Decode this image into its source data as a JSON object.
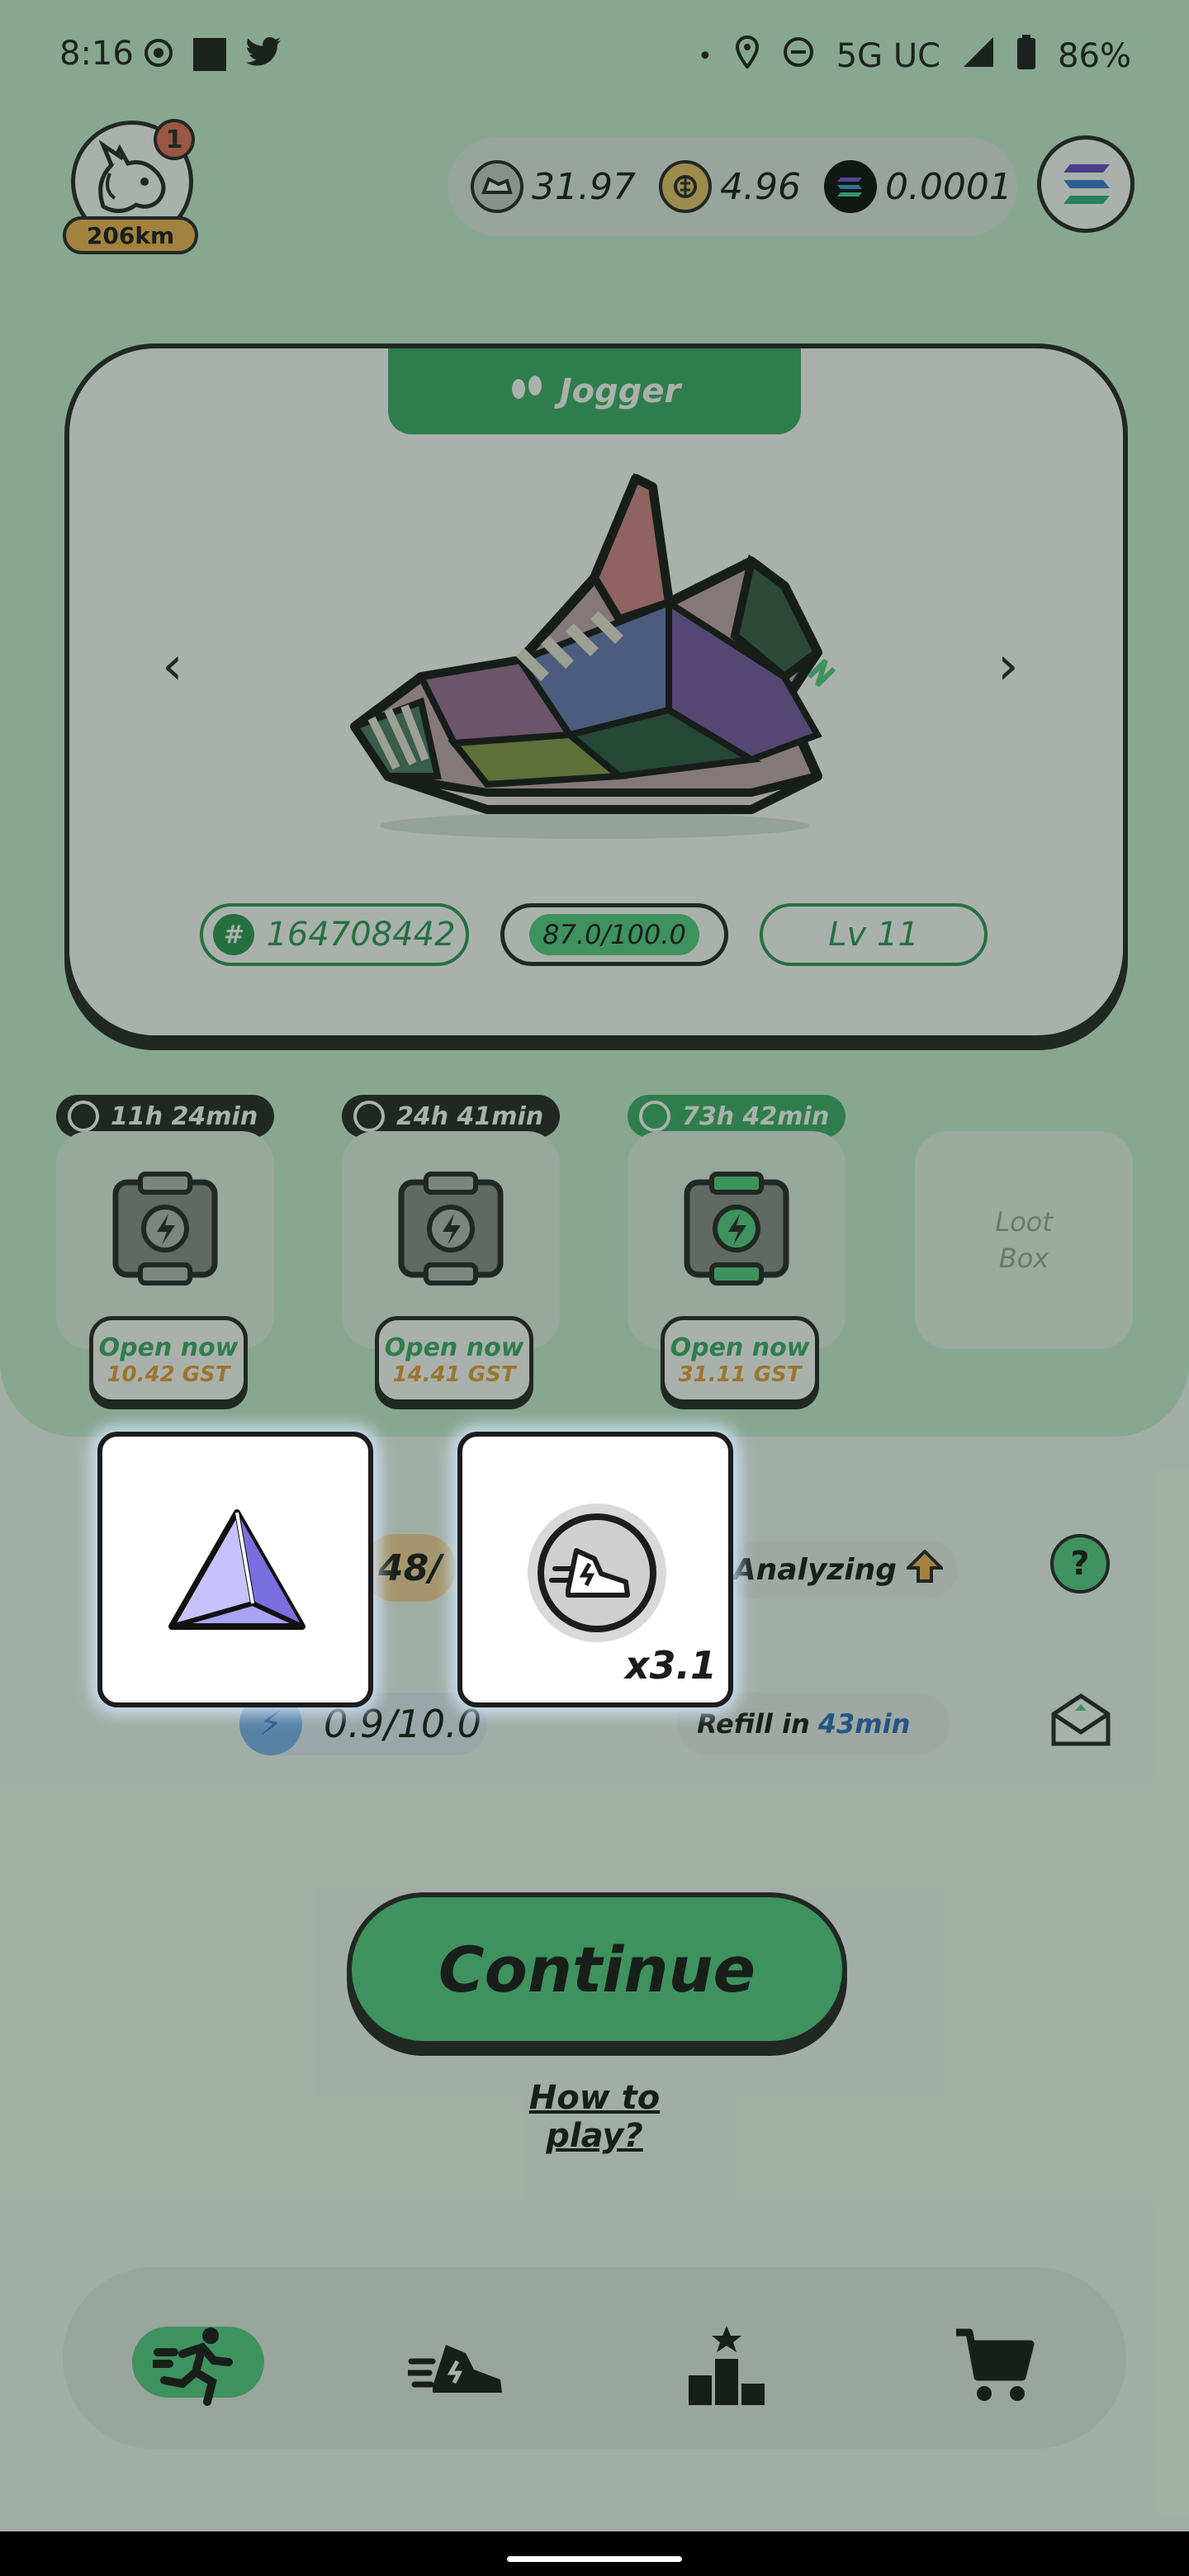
{
  "status_bar": {
    "time": "8:16",
    "network": "5G UC",
    "battery": "86%"
  },
  "profile": {
    "notification_count": "1",
    "distance": "206km"
  },
  "balances": [
    {
      "icon": "gst-shoe-coin-icon",
      "value": "31.97"
    },
    {
      "icon": "gmt-coin-icon",
      "value": "4.96"
    },
    {
      "icon": "solana-coin-icon",
      "value": "0.0001"
    }
  ],
  "sneaker_card": {
    "type": "Jogger",
    "id": "164708442",
    "durability": "87.0/100.0",
    "level": "Lv 11"
  },
  "mystery_boxes": [
    {
      "timer": "11h 24min",
      "open_label": "Open now",
      "cost": "10.42 GST",
      "active": false
    },
    {
      "timer": "24h 41min",
      "open_label": "Open now",
      "cost": "14.41 GST",
      "active": false
    },
    {
      "timer": "73h 42min",
      "open_label": "Open now",
      "cost": "31.11 GST",
      "active": true
    }
  ],
  "loot_box_placeholder": {
    "line1": "Loot",
    "line2": "Box"
  },
  "mint_progress_partial": "48/",
  "analyzing_label": "Analyzing",
  "energy": {
    "value": "0.9/10.0"
  },
  "refill": {
    "label": "Refill in",
    "minutes": "43min"
  },
  "rewards_overlay": {
    "items": [
      {
        "icon": "gem-pyramid-icon",
        "multiplier": ""
      },
      {
        "icon": "gst-shoe-coin-icon",
        "multiplier": "x3.1"
      }
    ]
  },
  "continue_label": "Continue",
  "how_to_play_label": "How to play?",
  "bottom_nav": [
    {
      "name": "run",
      "icon": "running-person-icon",
      "active": true
    },
    {
      "name": "sneakers",
      "icon": "sneaker-icon",
      "active": false
    },
    {
      "name": "leaderboard",
      "icon": "podium-icon",
      "active": false
    },
    {
      "name": "shop",
      "icon": "cart-icon",
      "active": false
    }
  ],
  "colors": {
    "accent_green": "#57cf86",
    "dark_green": "#3fae69",
    "gst_gold": "#e9a23c",
    "link_blue": "#2f6fc2",
    "outline": "#2a2a2a"
  }
}
